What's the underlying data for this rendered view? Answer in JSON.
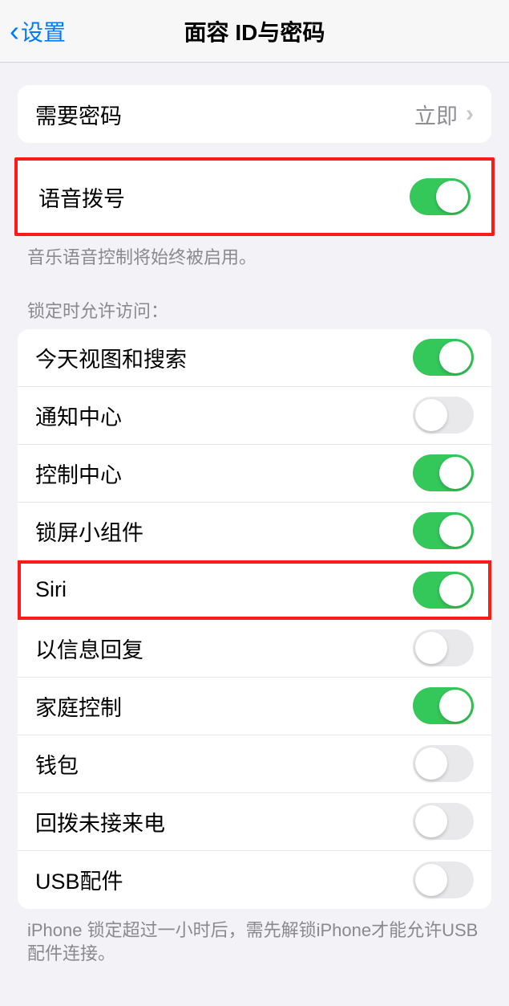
{
  "header": {
    "back_label": "设置",
    "title": "面容 ID与密码"
  },
  "group1": {
    "require_passcode_label": "需要密码",
    "require_passcode_value": "立即"
  },
  "voice_dial": {
    "label": "语音拨号",
    "on": true,
    "footer": "音乐语音控制将始终被启用。"
  },
  "locked_section": {
    "header": "锁定时允许访问：",
    "items": [
      {
        "label": "今天视图和搜索",
        "on": true
      },
      {
        "label": "通知中心",
        "on": false
      },
      {
        "label": "控制中心",
        "on": true
      },
      {
        "label": "锁屏小组件",
        "on": true
      },
      {
        "label": "Siri",
        "on": true
      },
      {
        "label": "以信息回复",
        "on": false
      },
      {
        "label": "家庭控制",
        "on": true
      },
      {
        "label": "钱包",
        "on": false
      },
      {
        "label": "回拨未接来电",
        "on": false
      },
      {
        "label": "USB配件",
        "on": false
      }
    ],
    "footer": "iPhone 锁定超过一小时后，需先解锁iPhone才能允许USB 配件连接。"
  }
}
